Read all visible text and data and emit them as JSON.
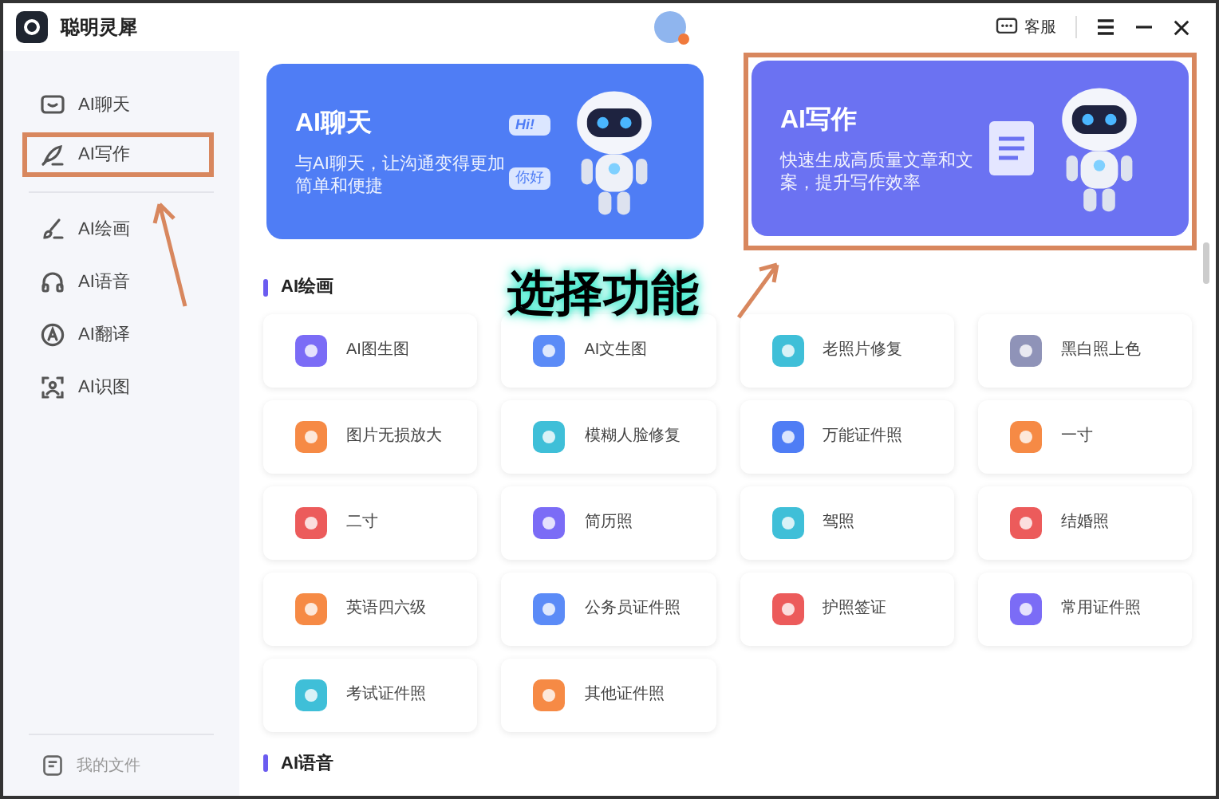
{
  "window": {
    "title": "聪明灵犀",
    "service": "客服"
  },
  "sidebar": {
    "items": [
      {
        "label": "AI聊天",
        "kind": "chat",
        "annotated": false
      },
      {
        "label": "AI写作",
        "kind": "write",
        "annotated": true
      },
      {
        "label": "AI绘画",
        "kind": "paint",
        "annotated": false
      },
      {
        "label": "AI语音",
        "kind": "voice",
        "annotated": false
      },
      {
        "label": "AI翻译",
        "kind": "translate",
        "annotated": false
      },
      {
        "label": "AI识图",
        "kind": "scan",
        "annotated": false
      }
    ],
    "footer": "我的文件"
  },
  "banners": [
    {
      "title": "AI聊天",
      "description": "与AI聊天，让沟通变得更加简单和便捷",
      "bubble_1": "Hi!",
      "bubble_2": "你好",
      "annotated": false,
      "color": "#4f7df5"
    },
    {
      "title": "AI写作",
      "description": "快速生成高质量文章和文案，提升写作效率",
      "annotated": true,
      "color": "#6b72f2"
    }
  ],
  "annotation": {
    "text": "选择功能"
  },
  "sections": [
    {
      "title": "AI绘画",
      "cards": [
        {
          "label": "AI图生图",
          "color": "#7b6cf6"
        },
        {
          "label": "AI文生图",
          "color": "#5b8bf7"
        },
        {
          "label": "老照片修复",
          "color": "#3fbfd8"
        },
        {
          "label": "黑白照上色",
          "color": "#8f93b8"
        },
        {
          "label": "图片无损放大",
          "color": "#f68a45"
        },
        {
          "label": "模糊人脸修复",
          "color": "#3fbfd8"
        },
        {
          "label": "万能证件照",
          "color": "#4f7df5"
        },
        {
          "label": "一寸",
          "color": "#f68a45"
        },
        {
          "label": "二寸",
          "color": "#ec5b5b"
        },
        {
          "label": "简历照",
          "color": "#7b6cf6"
        },
        {
          "label": "驾照",
          "color": "#3fbfd8"
        },
        {
          "label": "结婚照",
          "color": "#ec5b5b"
        },
        {
          "label": "英语四六级",
          "color": "#f68a45"
        },
        {
          "label": "公务员证件照",
          "color": "#5b8bf7"
        },
        {
          "label": "护照签证",
          "color": "#ec5b5b"
        },
        {
          "label": "常用证件照",
          "color": "#7b6cf6"
        },
        {
          "label": "考试证件照",
          "color": "#3fbfd8"
        },
        {
          "label": "其他证件照",
          "color": "#f68a45"
        }
      ]
    },
    {
      "title": "AI语音"
    }
  ]
}
